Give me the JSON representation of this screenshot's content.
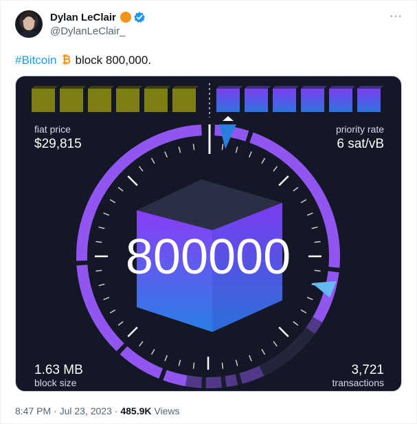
{
  "author": {
    "name": "Dylan LeClair",
    "handle": "@DylanLeClair_"
  },
  "tweet": {
    "hashtag": "#Bitcoin",
    "text": "block 800,000."
  },
  "visual": {
    "block_number": "800000",
    "fiat_price_label": "fiat price",
    "fiat_price_value": "$29,815",
    "priority_rate_label": "priority rate",
    "priority_rate_value": "6 sat/vB",
    "block_size_value": "1.63 MB",
    "block_size_label": "block size",
    "transactions_value": "3,721",
    "transactions_label": "transactions",
    "colors": {
      "background": "#141726",
      "mined_block": "#7d7f12",
      "pending_block": "#5b52e8",
      "ring": "#9156f0",
      "marker": "#1f6ed4"
    }
  },
  "footer": {
    "time": "8:47 PM",
    "date": "Jul 23, 2023",
    "views_count": "485.9K",
    "views_label": "Views"
  }
}
